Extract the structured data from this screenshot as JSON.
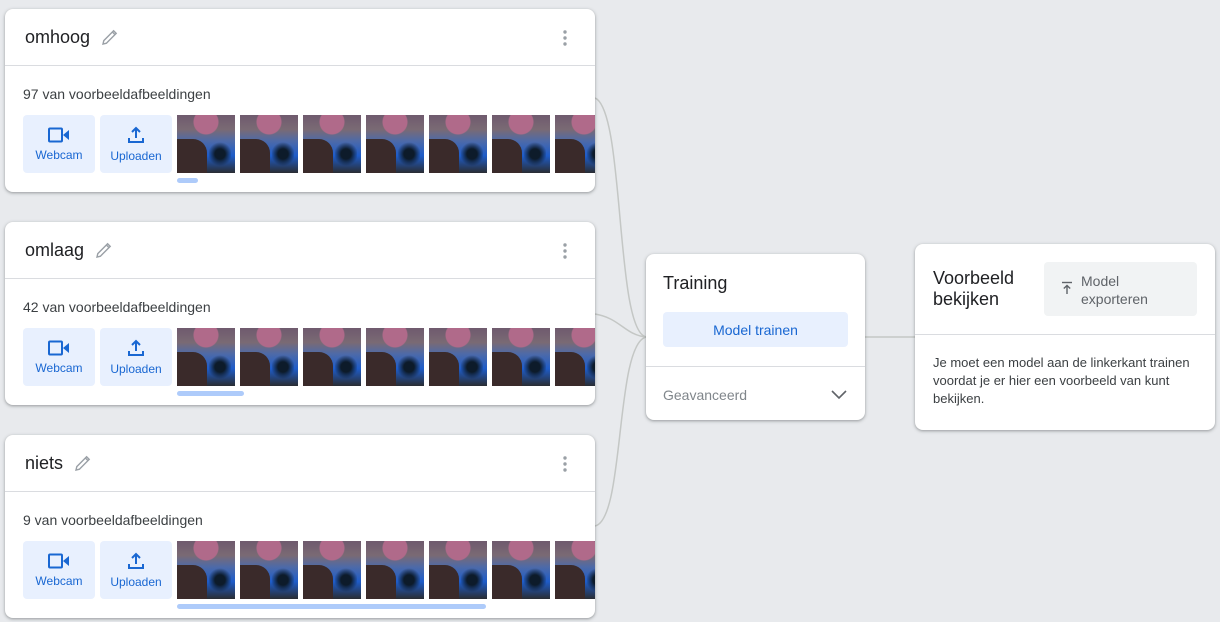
{
  "classes": [
    {
      "name": "omhoog",
      "count_label": "97 van voorbeeldafbeeldingen",
      "scroll_fraction": 0.05
    },
    {
      "name": "omlaag",
      "count_label": "42 van voorbeeldafbeeldingen",
      "scroll_fraction": 0.16
    },
    {
      "name": "niets",
      "count_label": "9 van voorbeeldafbeeldingen",
      "scroll_fraction": 0.74
    }
  ],
  "source_buttons": {
    "webcam": "Webcam",
    "upload": "Uploaden"
  },
  "icons": [
    "pencil-icon",
    "more-vert-icon",
    "videocam-icon",
    "upload-icon",
    "chevron-down-icon",
    "export-icon"
  ],
  "training": {
    "title": "Training",
    "train_button": "Model trainen",
    "advanced_label": "Geavanceerd"
  },
  "preview": {
    "title": "Voorbeeld bekijken",
    "export_button": "Model exporteren",
    "message": "Je moet een model aan de linkerkant trainen voordat je er hier een voorbeeld van kunt bekijken."
  },
  "colors": {
    "accent": "#1967d2",
    "accent_bg": "#e8f0fe",
    "page_bg": "#e8eaed",
    "scroll_track": "#aecbfa"
  }
}
